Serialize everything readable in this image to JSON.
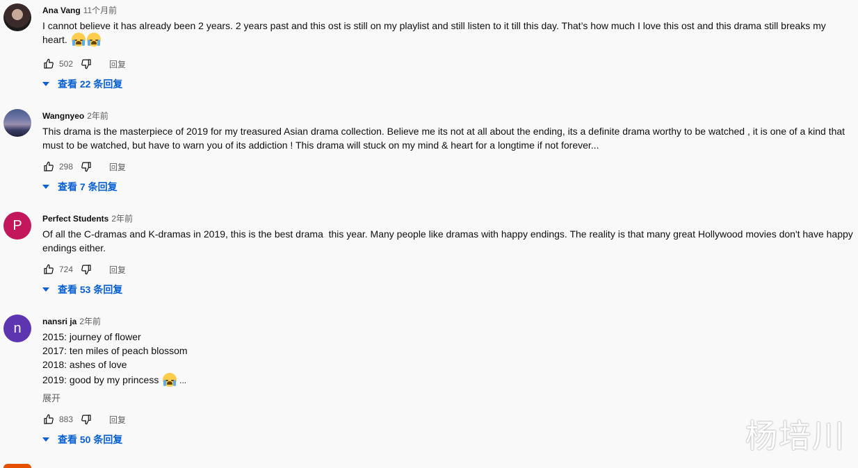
{
  "comments": [
    {
      "author": "Ana Vang",
      "time": "11个月前",
      "lines": [
        "I cannot believe it has already been 2 years. 2 years past and this ost is still on my playlist and still listen to it till this day. That’s how much I love this ost and this drama still breaks my",
        "heart."
      ],
      "likes": "502",
      "reply_label": "回复",
      "replies_label": "查看 22 条回复"
    },
    {
      "author": "Wangnyeo",
      "time": "2年前",
      "lines": [
        "This drama is the masterpiece of 2019 for my treasured Asian drama collection. Believe me its not at all about the ending, its a definite drama worthy to be watched , it is one of a kind that",
        "must to be watched, but have to warn you of its addiction ! This drama will stuck on my mind & heart for a longtime if not forever..."
      ],
      "likes": "298",
      "reply_label": "回复",
      "replies_label": "查看 7 条回复"
    },
    {
      "author": "Perfect Students",
      "time": "2年前",
      "avatar_letter": "P",
      "lines": [
        "Of all the C-dramas and K-dramas in 2019, this is the best drama  this year. Many people like dramas with happy endings. The reality is that many great Hollywood movies don't have happy",
        "endings either."
      ],
      "likes": "724",
      "reply_label": "回复",
      "replies_label": "查看 53 条回复"
    },
    {
      "author": "nansri ja",
      "time": "2年前",
      "avatar_letter": "n",
      "lines": [
        "2015: journey of flower",
        "2017: ten miles of peach blossom",
        "2018: ashes of love",
        "2019: good by my princess"
      ],
      "ellipsis": "...",
      "expand_label": "展开",
      "likes": "883",
      "reply_label": "回复",
      "replies_label": "查看 50 条回复"
    }
  ],
  "watermark": "杨培川",
  "colors": {
    "background": "#f9f9f9",
    "link_blue": "#065fd4",
    "muted": "#606060",
    "avatar_p": "#c2185b",
    "avatar_n": "#5e35b1"
  },
  "icons": [
    "thumbs-up-icon",
    "thumbs-down-icon",
    "caret-down-icon",
    "loudly-crying-face-emoji"
  ]
}
